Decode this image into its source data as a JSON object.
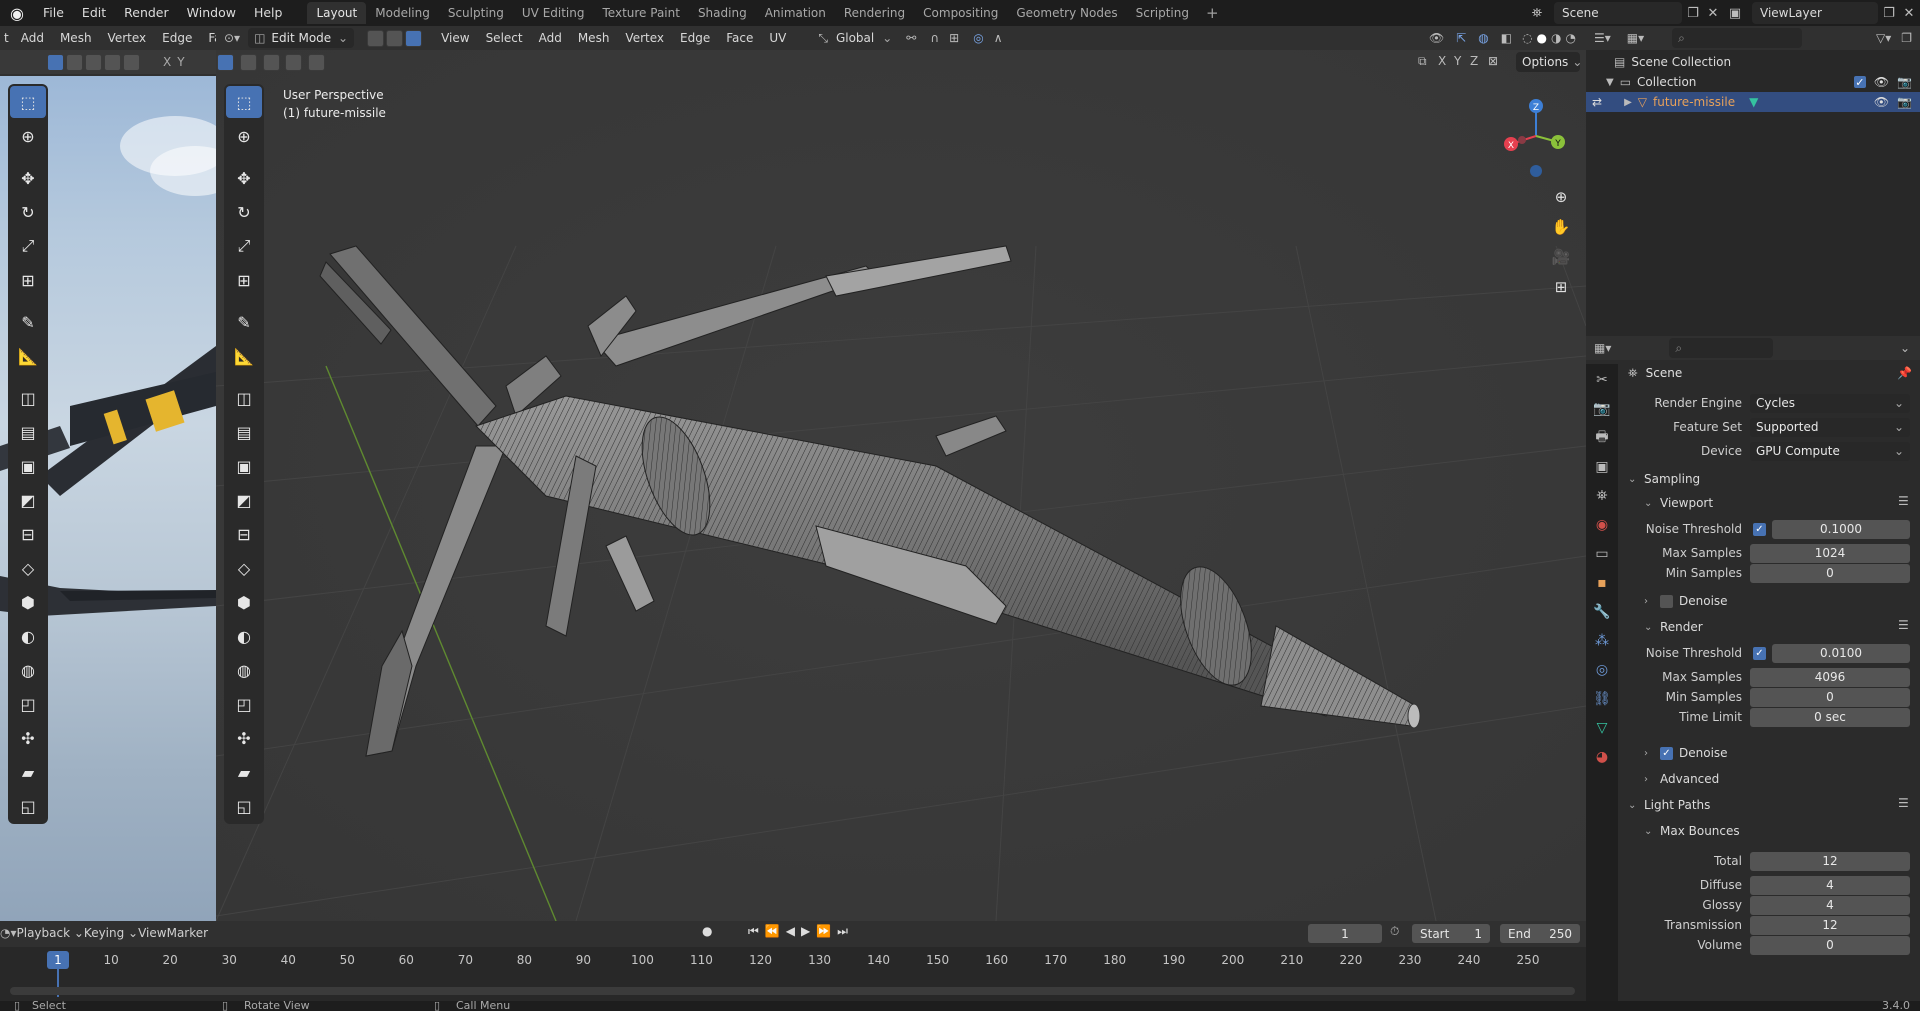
{
  "topbar": {
    "menus": [
      "File",
      "Edit",
      "Render",
      "Window",
      "Help"
    ],
    "workspaces": [
      "Layout",
      "Modeling",
      "Sculpting",
      "UV Editing",
      "Texture Paint",
      "Shading",
      "Animation",
      "Rendering",
      "Compositing",
      "Geometry Nodes",
      "Scripting"
    ],
    "active_workspace": "Layout",
    "scene_name": "Scene",
    "view_layer": "ViewLayer"
  },
  "left_viewport": {
    "menus": [
      "t",
      "Add",
      "Mesh",
      "Vertex",
      "Edge",
      "Face"
    ],
    "axes": [
      "X",
      "Y"
    ]
  },
  "viewport": {
    "mode": "Edit Mode",
    "menus": [
      "View",
      "Select",
      "Add",
      "Mesh",
      "Vertex",
      "Edge",
      "Face",
      "UV"
    ],
    "orientation": "Global",
    "options_label": "Options",
    "axes": [
      "X",
      "Y",
      "Z"
    ],
    "info_line1": "User Perspective",
    "info_line2": "(1) future-missile",
    "gizmo_labels": {
      "x": "X",
      "y": "Y",
      "z": "Z"
    }
  },
  "outliner": {
    "scene_collection": "Scene Collection",
    "collection": "Collection",
    "object": "future-missile"
  },
  "properties": {
    "context": "Scene",
    "render_engine_label": "Render Engine",
    "render_engine": "Cycles",
    "feature_set_label": "Feature Set",
    "feature_set": "Supported",
    "device_label": "Device",
    "device": "GPU Compute",
    "sampling": "Sampling",
    "viewport": "Viewport",
    "viewport_noise_threshold_label": "Noise Threshold",
    "viewport_noise_threshold": "0.1000",
    "viewport_max_samples_label": "Max Samples",
    "viewport_max_samples": "1024",
    "viewport_min_samples_label": "Min Samples",
    "viewport_min_samples": "0",
    "viewport_denoise": "Denoise",
    "render": "Render",
    "render_noise_threshold_label": "Noise Threshold",
    "render_noise_threshold": "0.0100",
    "render_max_samples_label": "Max Samples",
    "render_max_samples": "4096",
    "render_min_samples_label": "Min Samples",
    "render_min_samples": "0",
    "time_limit_label": "Time Limit",
    "time_limit": "0 sec",
    "render_denoise": "Denoise",
    "advanced": "Advanced",
    "light_paths": "Light Paths",
    "max_bounces": "Max Bounces",
    "total_label": "Total",
    "total": "12",
    "diffuse_label": "Diffuse",
    "diffuse": "4",
    "glossy_label": "Glossy",
    "glossy": "4",
    "transmission_label": "Transmission",
    "transmission": "12",
    "volume_label": "Volume",
    "volume": "0"
  },
  "timeline": {
    "menus": [
      "Playback",
      "Keying",
      "View",
      "Marker"
    ],
    "current_frame": "1",
    "start_label": "Start",
    "start": "1",
    "end_label": "End",
    "end": "250",
    "ticks": [
      "1",
      "10",
      "20",
      "30",
      "40",
      "50",
      "60",
      "70",
      "80",
      "90",
      "100",
      "110",
      "120",
      "130",
      "140",
      "150",
      "160",
      "170",
      "180",
      "190",
      "200",
      "210",
      "220",
      "230",
      "240",
      "250"
    ]
  },
  "statusbar": {
    "select": "Select",
    "rotate_view": "Rotate View",
    "call_menu": "Call Menu",
    "version": "3.4.0"
  },
  "colors": {
    "accent": "#4772b3",
    "selection": "#334d80",
    "axis_x": "#e5404f",
    "axis_y": "#8bc13a",
    "axis_z": "#3d7fd6",
    "object_orange": "#e7a15a"
  }
}
